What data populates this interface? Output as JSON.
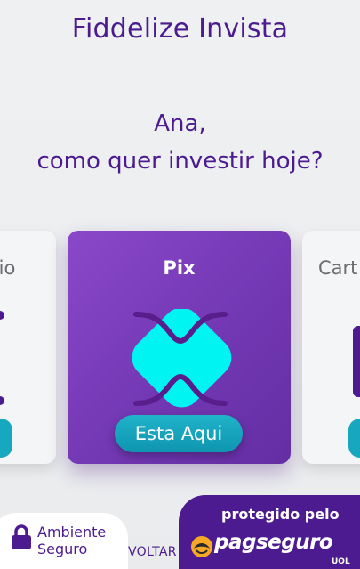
{
  "header": {
    "title": "Fiddelize Invista"
  },
  "greeting": {
    "line1": "Ana,",
    "line2": "como quer investir hoje?"
  },
  "carousel": {
    "left_card_label": "rio",
    "center_card": {
      "label": "Pix",
      "icon": "pix-icon",
      "button_label": "Esta Aqui"
    },
    "right_card_label": "Cart"
  },
  "footer": {
    "secure_label_line1": "Ambiente",
    "secure_label_line2": "Seguro",
    "back_link": "VOLTAR M",
    "badge_top": "protegido pelo",
    "badge_brand": "pagseguro",
    "badge_sub": "UOL"
  },
  "colors": {
    "brand_purple": "#4b1b8f",
    "card_purple": "#7338b4",
    "accent_teal": "#1fb3c9",
    "pix_cyan": "#00f5f2"
  }
}
